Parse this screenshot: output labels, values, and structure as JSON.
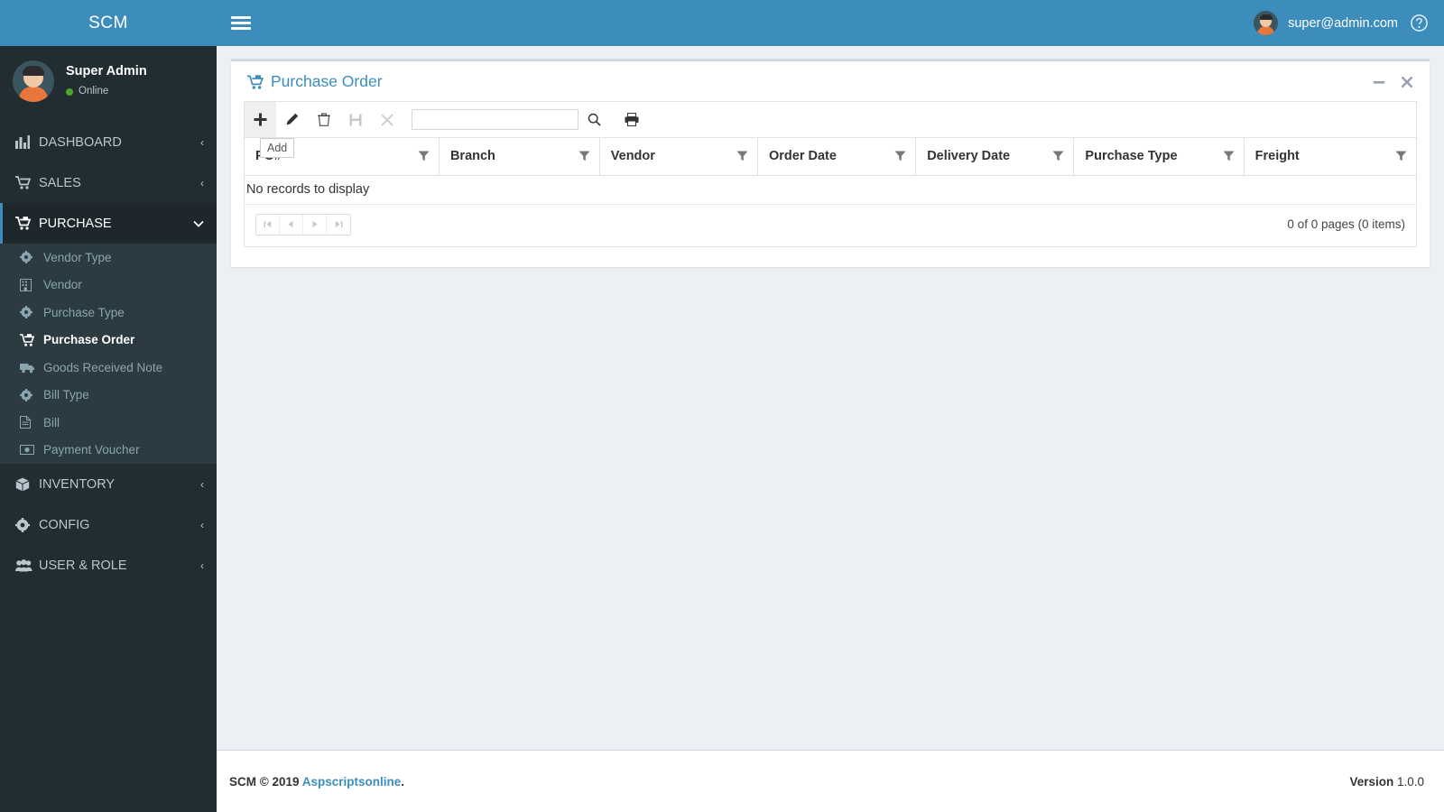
{
  "app": {
    "logo": "SCM",
    "accent_color": "#3c8dbc",
    "sidebar_color": "#222d32"
  },
  "profile": {
    "name": "Super Admin",
    "status": "Online",
    "status_color": "#4fa72a"
  },
  "topbar": {
    "menu_toggle": "hamburger-icon",
    "email": "super@admin.com",
    "help": "?"
  },
  "sidebar": {
    "items": [
      {
        "label": "DASHBOARD",
        "icon": "bar-chart-icon",
        "chevron": "‹",
        "expanded": false
      },
      {
        "label": "SALES",
        "icon": "cart-icon",
        "chevron": "‹",
        "expanded": false
      },
      {
        "label": "PURCHASE",
        "icon": "cart-flag-icon",
        "chevron": "⌄",
        "expanded": true
      },
      {
        "label": "INVENTORY",
        "icon": "box-icon",
        "chevron": "‹",
        "expanded": false
      },
      {
        "label": "CONFIG",
        "icon": "gear-icon",
        "chevron": "‹",
        "expanded": false
      },
      {
        "label": "USER & ROLE",
        "icon": "users-icon",
        "chevron": "‹",
        "expanded": false
      }
    ],
    "purchase_submenu": [
      {
        "label": "Vendor Type",
        "icon": "gear-icon",
        "active": false
      },
      {
        "label": "Vendor",
        "icon": "building-icon",
        "active": false
      },
      {
        "label": "Purchase Type",
        "icon": "gear-icon",
        "active": false
      },
      {
        "label": "Purchase Order",
        "icon": "cart-flag-icon",
        "active": true
      },
      {
        "label": "Goods Received Note",
        "icon": "truck-icon",
        "active": false
      },
      {
        "label": "Bill Type",
        "icon": "gear-icon",
        "active": false
      },
      {
        "label": "Bill",
        "icon": "document-icon",
        "active": false
      },
      {
        "label": "Payment Voucher",
        "icon": "money-icon",
        "active": false
      }
    ]
  },
  "panel": {
    "title": "Purchase Order",
    "title_icon": "cart-flag-icon",
    "minimize": "−",
    "close": "✕"
  },
  "toolbar": {
    "buttons": [
      {
        "name": "add-button",
        "icon": "plus-icon",
        "label": "Add",
        "disabled": false,
        "hovered": true
      },
      {
        "name": "edit-button",
        "icon": "pencil-icon",
        "label": "Edit",
        "disabled": false,
        "hovered": false
      },
      {
        "name": "delete-button",
        "icon": "trash-icon",
        "label": "Delete",
        "disabled": false,
        "hovered": false
      },
      {
        "name": "save-button",
        "icon": "save-icon",
        "label": "Save",
        "disabled": true,
        "hovered": false
      },
      {
        "name": "cancel-button",
        "icon": "close-icon",
        "label": "Cancel",
        "disabled": true,
        "hovered": false
      }
    ],
    "tooltip": "Add",
    "search_value": "",
    "search_placeholder": "",
    "search_icon": "search-icon",
    "print_icon": "print-icon"
  },
  "grid": {
    "columns": [
      {
        "label": "PO#",
        "filter_icon": "filter-icon"
      },
      {
        "label": "Branch",
        "filter_icon": "filter-icon"
      },
      {
        "label": "Vendor",
        "filter_icon": "filter-icon"
      },
      {
        "label": "Order Date",
        "filter_icon": "filter-icon"
      },
      {
        "label": "Delivery Date",
        "filter_icon": "filter-icon"
      },
      {
        "label": "Purchase Type",
        "filter_icon": "filter-icon"
      },
      {
        "label": "Freight",
        "filter_icon": "filter-icon"
      }
    ],
    "rows": [],
    "empty_message": "No records to display",
    "pagination": {
      "first": "⏮",
      "prev": "◀",
      "next": "▶",
      "last": "⏭",
      "info": "0 of 0 pages (0 items)"
    }
  },
  "footer": {
    "copyright_prefix": "SCM © 2019 ",
    "link": "Aspscriptsonline",
    "copyright_suffix": ".",
    "version_label": "Version",
    "version_number": " 1.0.0"
  }
}
